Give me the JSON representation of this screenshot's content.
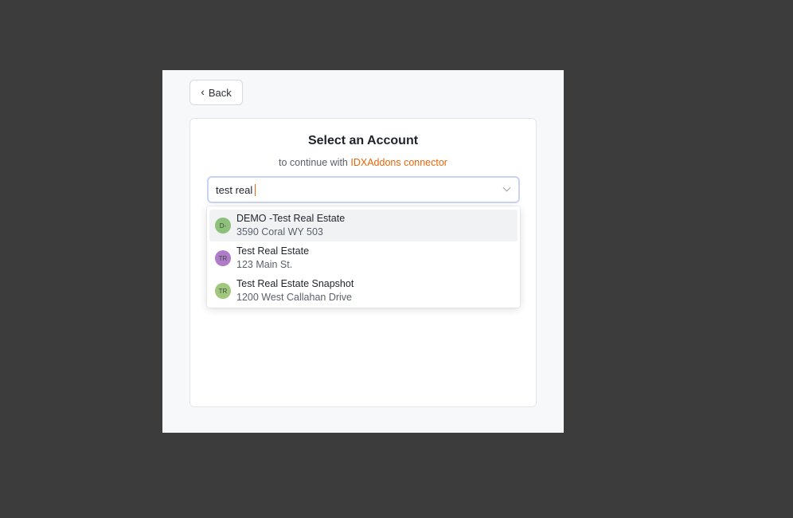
{
  "back_button": {
    "label": "Back"
  },
  "card": {
    "title": "Select an Account",
    "subtitle_prefix": "to continue with",
    "subtitle_link": "IDXAddons connector"
  },
  "search": {
    "value": "test real"
  },
  "accounts": [
    {
      "initials": "D-",
      "name": "DEMO -Test Real Estate",
      "address": "3590 Coral WY 503",
      "avatar_color": "#8dc07a",
      "highlighted": true
    },
    {
      "initials": "TR",
      "name": "Test Real Estate",
      "address": "123 Main St.",
      "avatar_color": "#b07cc9",
      "highlighted": false
    },
    {
      "initials": "TR",
      "name": "Test Real Estate Snapshot",
      "address": "1200 West Callahan Drive",
      "avatar_color": "#9fc77e",
      "highlighted": false
    }
  ],
  "colors": {
    "accent": "#e8650a",
    "backdrop": "#3c3c3c",
    "focus_border": "#c9d3f3"
  },
  "icons": {
    "back": "chevron-left-icon",
    "dropdown": "chevron-down-icon"
  }
}
